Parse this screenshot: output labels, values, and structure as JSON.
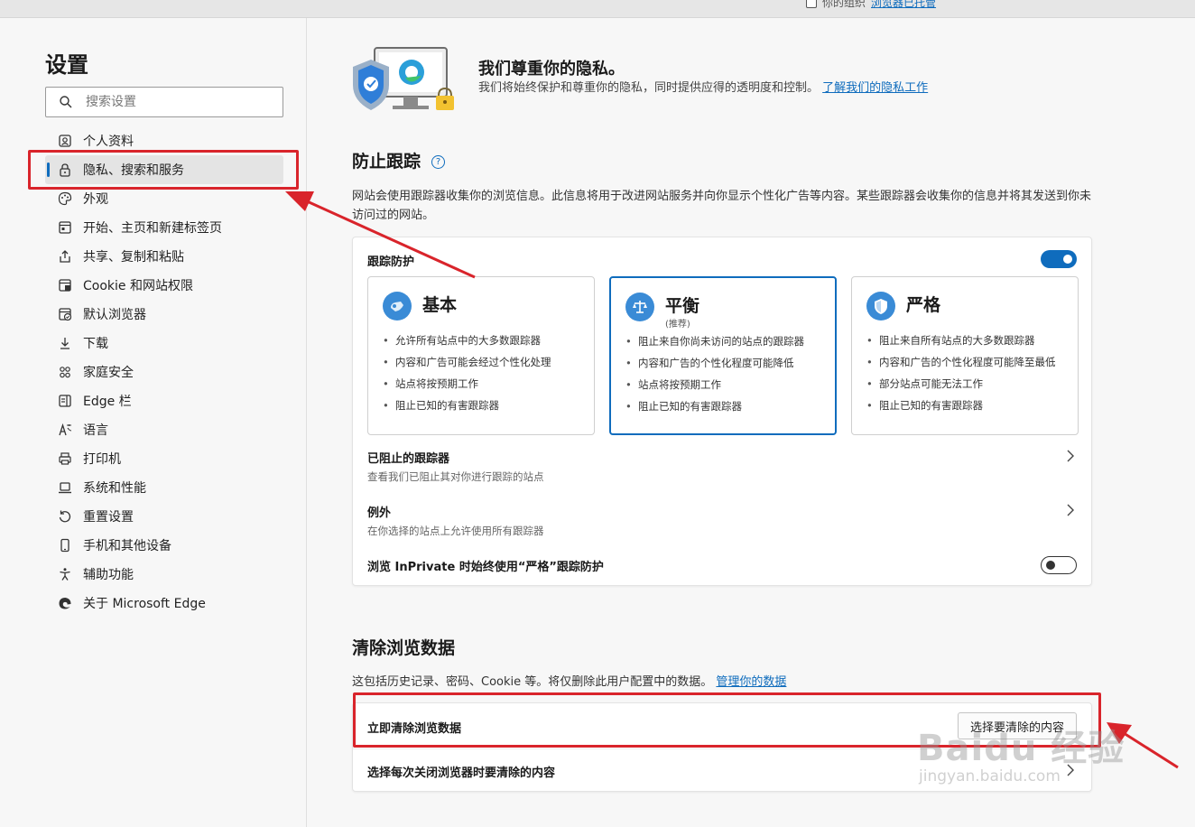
{
  "topbar": {
    "managed_text": "你的组织",
    "managed_link": "浏览器已托管"
  },
  "sidebar": {
    "title": "设置",
    "search_placeholder": "搜索设置",
    "items": [
      {
        "label": "个人资料",
        "icon": "profile-icon"
      },
      {
        "label": "隐私、搜索和服务",
        "icon": "lock-icon",
        "active": true
      },
      {
        "label": "外观",
        "icon": "palette-icon"
      },
      {
        "label": "开始、主页和新建标签页",
        "icon": "home-tabs-icon"
      },
      {
        "label": "共享、复制和粘贴",
        "icon": "share-icon"
      },
      {
        "label": "Cookie 和网站权限",
        "icon": "site-permissions-icon"
      },
      {
        "label": "默认浏览器",
        "icon": "default-browser-icon"
      },
      {
        "label": "下载",
        "icon": "download-icon"
      },
      {
        "label": "家庭安全",
        "icon": "family-icon"
      },
      {
        "label": "Edge 栏",
        "icon": "edge-bar-icon"
      },
      {
        "label": "语言",
        "icon": "language-icon"
      },
      {
        "label": "打印机",
        "icon": "printer-icon"
      },
      {
        "label": "系统和性能",
        "icon": "laptop-icon"
      },
      {
        "label": "重置设置",
        "icon": "reset-icon"
      },
      {
        "label": "手机和其他设备",
        "icon": "phone-icon"
      },
      {
        "label": "辅助功能",
        "icon": "accessibility-icon"
      },
      {
        "label": "关于 Microsoft Edge",
        "icon": "edge-logo-icon"
      }
    ]
  },
  "hero": {
    "title": "我们尊重你的隐私。",
    "desc": "我们将始终保护和尊重你的隐私，同时提供应得的透明度和控制。",
    "link": "了解我们的隐私工作"
  },
  "tracking": {
    "title": "防止跟踪",
    "desc": "网站会使用跟踪器收集你的浏览信息。此信息将用于改进网站服务并向你显示个性化广告等内容。某些跟踪器会收集你的信息并将其发送到你未访问过的网站。",
    "toggle_label": "跟踪防护",
    "toggle_on": true,
    "options": [
      {
        "name": "基本",
        "sub": "",
        "bullets": [
          "允许所有站点中的大多数跟踪器",
          "内容和广告可能会经过个性化处理",
          "站点将按预期工作",
          "阻止已知的有害跟踪器"
        ]
      },
      {
        "name": "平衡",
        "sub": "(推荐)",
        "selected": true,
        "bullets": [
          "阻止来自你尚未访问的站点的跟踪器",
          "内容和广告的个性化程度可能降低",
          "站点将按预期工作",
          "阻止已知的有害跟踪器"
        ]
      },
      {
        "name": "严格",
        "sub": "",
        "bullets": [
          "阻止来自所有站点的大多数跟踪器",
          "内容和广告的个性化程度可能降至最低",
          "部分站点可能无法工作",
          "阻止已知的有害跟踪器"
        ]
      }
    ],
    "blocked_title": "已阻止的跟踪器",
    "blocked_sub": "查看我们已阻止其对你进行跟踪的站点",
    "exceptions_title": "例外",
    "exceptions_sub": "在你选择的站点上允许使用所有跟踪器",
    "inprivate_label": "浏览 InPrivate 时始终使用“严格”跟踪防护",
    "inprivate_on": false
  },
  "clear": {
    "title": "清除浏览数据",
    "desc": "这包括历史记录、密码、Cookie 等。将仅删除此用户配置中的数据。",
    "desc_link": "管理你的数据",
    "now_label": "立即清除浏览数据",
    "choose_button": "选择要清除的内容",
    "on_close_label": "选择每次关闭浏览器时要清除的内容"
  },
  "watermark": {
    "line1": "Baidu 经验",
    "line2": "jingyan.baidu.com"
  },
  "colors": {
    "accent": "#0f6cbd",
    "annotation": "#d9242b"
  }
}
